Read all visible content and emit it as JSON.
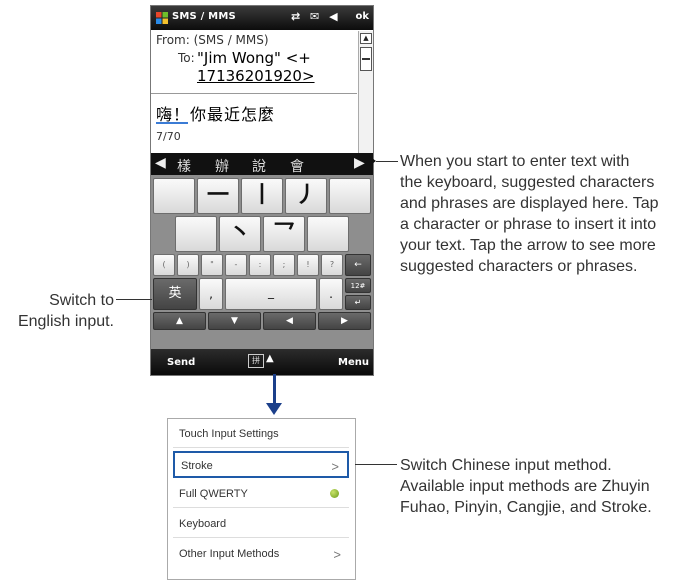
{
  "status_bar": {
    "title": "SMS / MMS",
    "icons_text": "⇄ ✉ ◀",
    "ok_label": "ok"
  },
  "message": {
    "from_label": "From:",
    "from_value": "(SMS / MMS)",
    "to_label": "To:",
    "to_line1": "\"Jim Wong\" <+",
    "to_line2": "17136201920>",
    "body_text": "嗨！你最近怎麼",
    "counter": "7/70"
  },
  "suggestions": {
    "left_arrow": "◀",
    "right_arrow": "▶",
    "chars": [
      "樣",
      "辦",
      "說",
      "會"
    ]
  },
  "keyboard": {
    "row1": [
      "",
      "一",
      "丨",
      "丿",
      ""
    ],
    "row2": [
      "",
      "丶",
      "乛",
      ""
    ],
    "row3": [
      "(",
      ")",
      "\"",
      "-",
      ":",
      ";",
      "!",
      "?",
      "←"
    ],
    "row4": [
      "英",
      ",",
      "_",
      ".",
      "12#",
      "↵"
    ],
    "row5": [
      "▲",
      "▼",
      "◀",
      "▶"
    ]
  },
  "softkeys": {
    "left": "Send",
    "ime_icon": "拼",
    "caret": "▲",
    "right": "Menu"
  },
  "callouts": {
    "suggestions": [
      "When you start to enter text with",
      "the keyboard, suggested characters",
      "and phrases are displayed here. Tap",
      "a character or phrase to insert it into",
      "your text. Tap the arrow to see more",
      "suggested characters or phrases."
    ],
    "english": [
      "Switch to",
      "English input."
    ],
    "input_methods": [
      "Switch Chinese input method.",
      "Available input methods are Zhuyin",
      "Fuhao, Pinyin, Cangjie, and Stroke."
    ]
  },
  "input_menu": {
    "items": [
      {
        "label": "Touch Input Settings"
      },
      {
        "label": "Stroke",
        "chevron": ">"
      },
      {
        "label": "Full QWERTY"
      },
      {
        "label": "Keyboard"
      },
      {
        "label": "Other Input Methods",
        "chevron": ">"
      }
    ],
    "selected": "Stroke"
  },
  "colors": {
    "accent": "#1b3f8a",
    "selection_border": "#1e5aa8",
    "active_dot": "#6a9a18"
  }
}
